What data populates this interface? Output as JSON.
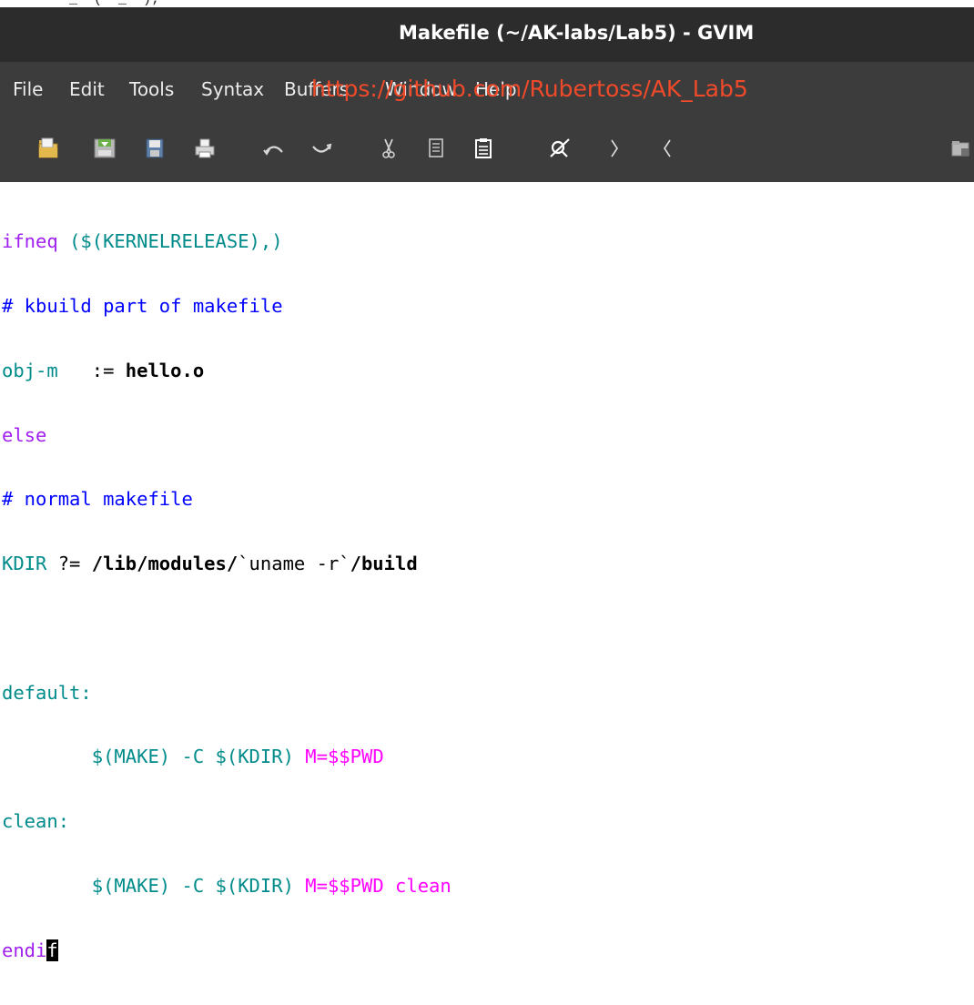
{
  "top_strip": {
    "text": "        _  (  _  );"
  },
  "window": {
    "title": "Makefile (~/AK-labs/Lab5) - GVIM"
  },
  "menu": {
    "items": [
      "File",
      "Edit",
      "Tools",
      "Syntax",
      "Buffers",
      "Window",
      "Help"
    ]
  },
  "watermark": "https://github.com/Rubertoss/AK_Lab5",
  "toolbar": {
    "buttons": [
      "open-icon",
      "save-icon",
      "save-all-icon",
      "print-icon",
      "undo-icon",
      "redo-icon",
      "cut-icon",
      "copy-icon",
      "paste-icon",
      "find-replace-icon",
      "find-next-icon",
      "find-previous-icon",
      "load-session-icon"
    ]
  },
  "editor": {
    "l1": {
      "a": "ifneq",
      "b": " ",
      "c": "($(KERNELRELEASE),)"
    },
    "l2": "# kbuild part of makefile",
    "l3": {
      "a": "obj-m",
      "b": "   := ",
      "c": "hello.o"
    },
    "l4": "else",
    "l5": "# normal makefile",
    "l6": {
      "a": "KDIR",
      "b": " ?= ",
      "c": "/lib/modules/",
      "d": "`uname -r`",
      "e": "/build"
    },
    "l7": "",
    "l8": "default:",
    "l9": {
      "indent": "        ",
      "a": "$(MAKE)",
      "b": " -C ",
      "c": "$(KDIR)",
      "d": " M=$$PWD"
    },
    "l10": "clean:",
    "l11": {
      "indent": "        ",
      "a": "$(MAKE)",
      "b": " -C ",
      "c": "$(KDIR)",
      "d": " M=$$PWD clean"
    },
    "l12": {
      "a": "endi",
      "cursor": "f"
    }
  }
}
